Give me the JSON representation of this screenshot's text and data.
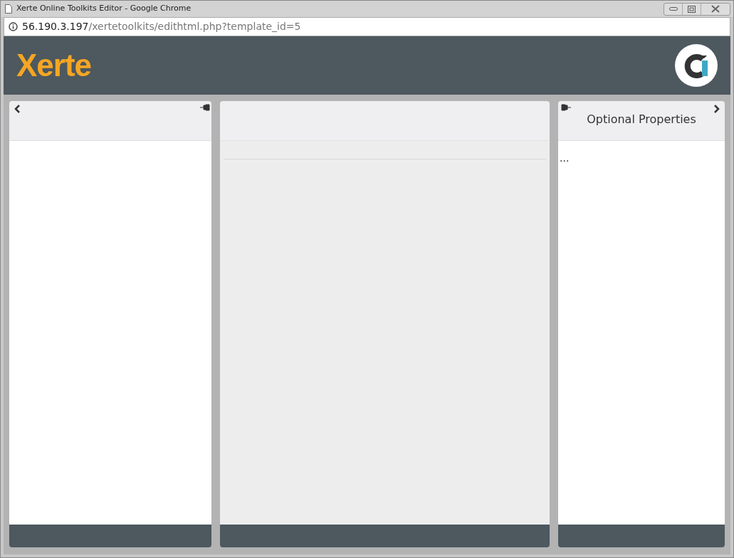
{
  "window": {
    "title": "Xerte Online Toolkits Editor - Google Chrome"
  },
  "address_bar": {
    "host": "56.190.3.197",
    "path": "/xertetoolkits/edithtml.php?template_id=5"
  },
  "header": {
    "logo": "Xerte"
  },
  "right_panel": {
    "title": "Optional Properties",
    "content": "..."
  }
}
